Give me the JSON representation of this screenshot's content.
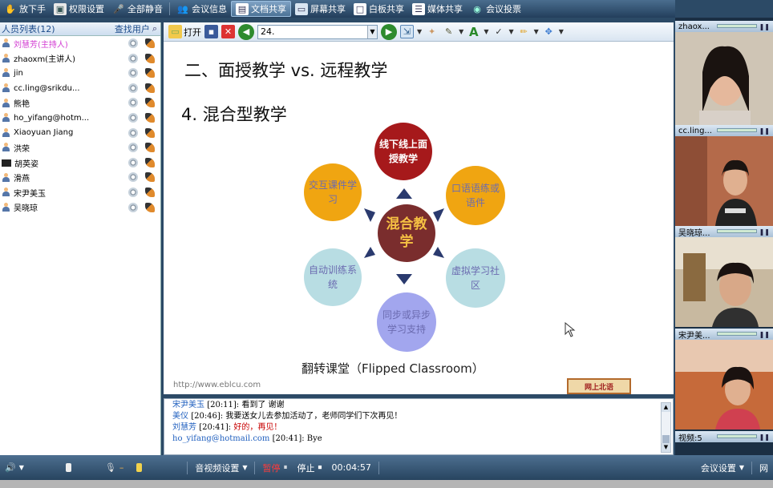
{
  "toolbar": {
    "items": [
      {
        "label": "放下手",
        "icon": "hand-icon"
      },
      {
        "label": "权限设置",
        "icon": "permission-icon"
      },
      {
        "label": "全部静音",
        "icon": "mute-icon"
      },
      {
        "label": "会议信息",
        "icon": "meeting-info-icon"
      },
      {
        "label": "文档共享",
        "icon": "document-share-icon",
        "active": true
      },
      {
        "label": "屏幕共享",
        "icon": "screen-share-icon"
      },
      {
        "label": "白板共享",
        "icon": "whiteboard-icon"
      },
      {
        "label": "媒体共享",
        "icon": "media-share-icon"
      },
      {
        "label": "会议投票",
        "icon": "vote-icon"
      }
    ]
  },
  "userlist": {
    "title": "人员列表(12)",
    "search_label": "查找用户",
    "users": [
      {
        "name": "刘慧芳(主持人)",
        "host": true
      },
      {
        "name": "zhaoxm(主讲人)"
      },
      {
        "name": "jin"
      },
      {
        "name": "cc.ling@srikdu..."
      },
      {
        "name": "熊艳"
      },
      {
        "name": "ho_yifang@hotm..."
      },
      {
        "name": "Xiaoyuan Jiang"
      },
      {
        "name": "洪荣"
      },
      {
        "name": "胡英姿",
        "screen": true
      },
      {
        "name": "滑燕"
      },
      {
        "name": "宋尹美玉"
      },
      {
        "name": "吴晓琼"
      }
    ]
  },
  "doc_toolbar": {
    "open_label": "打开",
    "page_value": "24."
  },
  "slide": {
    "title": "二、面授教学 vs. 远程教学",
    "subtitle": "4. 混合型教学",
    "center": "混合教学",
    "nodes": {
      "top": "线下线上面授教学",
      "top_right": "口语语练或语件",
      "bottom_right": "虚拟学习社区",
      "bottom": "同步或异步学习支持",
      "bottom_left": "自动训练系统",
      "top_left": "交互课件学习"
    },
    "caption": "翻转课堂（Flipped Classroom）",
    "url": "http://www.eblcu.com",
    "logo": "网上北语"
  },
  "chat": {
    "messages": [
      {
        "name": "宋尹美玉",
        "time": "[20:11]:",
        "text": "看到了 谢谢"
      },
      {
        "name": "美仪",
        "time": "[20:46]:",
        "text": "我要送女儿去参加活动了，老师同学们下次再见！"
      },
      {
        "name": "刘慧芳",
        "time": "[20:41]:",
        "text": "好的，再见！",
        "host": true
      },
      {
        "name": "ho_yifang@hotmail.com",
        "time": "[20:41]:",
        "text": "Bye"
      }
    ]
  },
  "videos": [
    {
      "name": "zhaox..."
    },
    {
      "name": "cc.ling..."
    },
    {
      "name": "吴晓琼..."
    },
    {
      "name": "宋尹美..."
    },
    {
      "name": "视频:5"
    }
  ],
  "bottombar": {
    "av_settings": "音视频设置",
    "pause": "暂停",
    "stop": "停止",
    "timer": "00:04:57",
    "meeting_settings": "会议设置",
    "more": "网"
  },
  "colors": {
    "host": "#d23bd2",
    "accent": "#2c4a66"
  }
}
